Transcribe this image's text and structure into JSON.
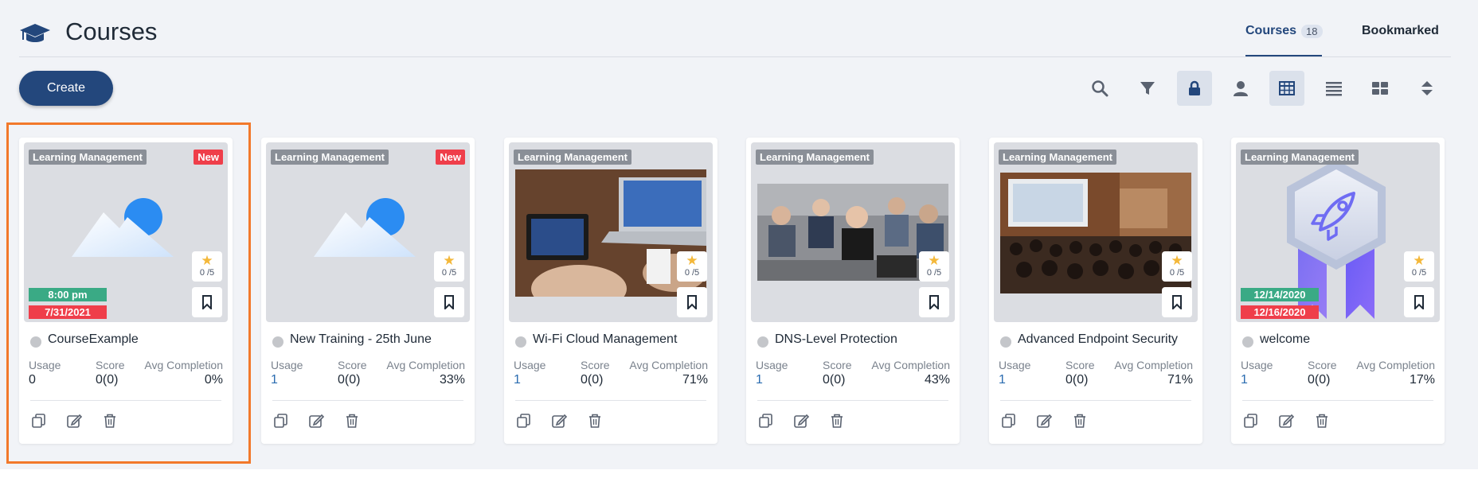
{
  "header": {
    "title": "Courses",
    "tabs": [
      {
        "label": "Courses",
        "count": "18"
      },
      {
        "label": "Bookmarked"
      }
    ]
  },
  "toolbar": {
    "create_label": "Create",
    "icons": [
      "search-icon",
      "filter-icon",
      "lock-icon",
      "user-icon",
      "table-view-icon",
      "list-view-icon",
      "grid-view-icon",
      "sort-icon"
    ]
  },
  "stat_labels": {
    "usage": "Usage",
    "score": "Score",
    "avg": "Avg Completion"
  },
  "cards": [
    {
      "category": "Learning Management",
      "new": "New",
      "title": "CourseExample",
      "rating": "0 /5",
      "time": "8:00 pm",
      "date": "7/31/2021",
      "usage": "0",
      "score": "0(0)",
      "avg": "0%"
    },
    {
      "category": "Learning Management",
      "new": "New",
      "title": "New Training - 25th June",
      "rating": "0 /5",
      "usage": "1",
      "score": "0(0)",
      "avg": "33%"
    },
    {
      "category": "Learning Management",
      "title": "Wi-Fi Cloud Management",
      "rating": "0 /5",
      "usage": "1",
      "score": "0(0)",
      "avg": "71%"
    },
    {
      "category": "Learning Management",
      "title": "DNS-Level Protection",
      "rating": "0 /5",
      "usage": "1",
      "score": "0(0)",
      "avg": "43%"
    },
    {
      "category": "Learning Management",
      "title": "Advanced Endpoint Security",
      "rating": "0 /5",
      "usage": "1",
      "score": "0(0)",
      "avg": "71%"
    },
    {
      "category": "Learning Management",
      "title": "welcome",
      "rating": "0 /5",
      "start_date": "12/14/2020",
      "end_date": "12/16/2020",
      "usage": "1",
      "score": "0(0)",
      "avg": "17%"
    }
  ],
  "colors": {
    "brand": "#23477c",
    "new": "#ef3e4a",
    "time": "#3aaa85",
    "highlight": "#f2792b",
    "star": "#f4b83a"
  }
}
